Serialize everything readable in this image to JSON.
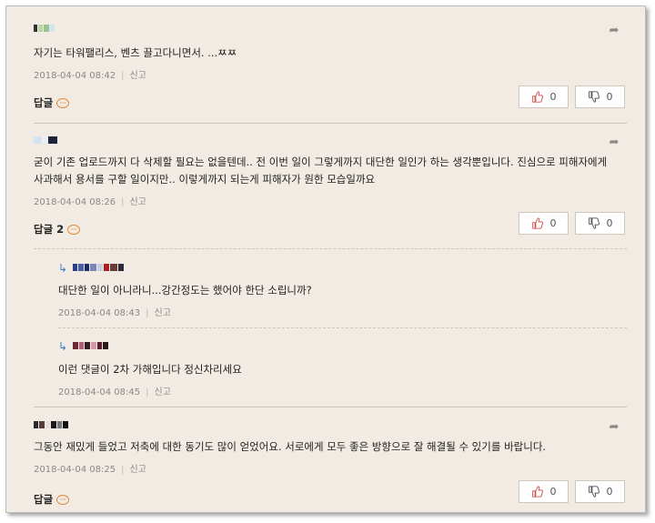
{
  "labels": {
    "reply": "답글",
    "report": "신고",
    "separator": "|"
  },
  "colors": {
    "panel_bg": "#f2ebe3",
    "like_icon": "#d9534f",
    "dislike_icon": "#555555",
    "accent": "#e08a38"
  },
  "comments": [
    {
      "author_icon": "pixelated-avatar",
      "text": "자기는 타워팰리스, 벤츠 끌고다니면서. ...ㅉㅉ",
      "date": "2018-04-04 08:42",
      "reply_label": "답글",
      "likes": "0",
      "dislikes": "0"
    },
    {
      "author_icon": "pixelated-avatar",
      "text": "굳이 기존 업로드까지 다 삭제할 필요는 없을텐데.. 전 이번 일이 그렇게까지 대단한 일인가 하는 생각뿐입니다. 진심으로 피해자에게 사과해서 용서를 구할 일이지만.. 이렇게까지 되는게 피해자가 원한 모습일까요",
      "date": "2018-04-04 08:26",
      "reply_label": "답글 2",
      "likes": "0",
      "dislikes": "0",
      "replies": [
        {
          "text": "대단한 일이 아니라니...강간정도는 했어야 한단 소립니까?",
          "date": "2018-04-04 08:43"
        },
        {
          "text": "이런 댓글이 2차 가해입니다 정신차리세요",
          "date": "2018-04-04 08:45"
        }
      ]
    },
    {
      "author_icon": "pixelated-avatar",
      "text": "그동안 재밌게 들었고 저축에 대한 동기도 많이 얻었어요. 서로에게 모두 좋은 방향으로 잘 해결될 수 있기를 바랍니다.",
      "date": "2018-04-04 08:25",
      "reply_label": "답글",
      "likes": "0",
      "dislikes": "0"
    }
  ]
}
